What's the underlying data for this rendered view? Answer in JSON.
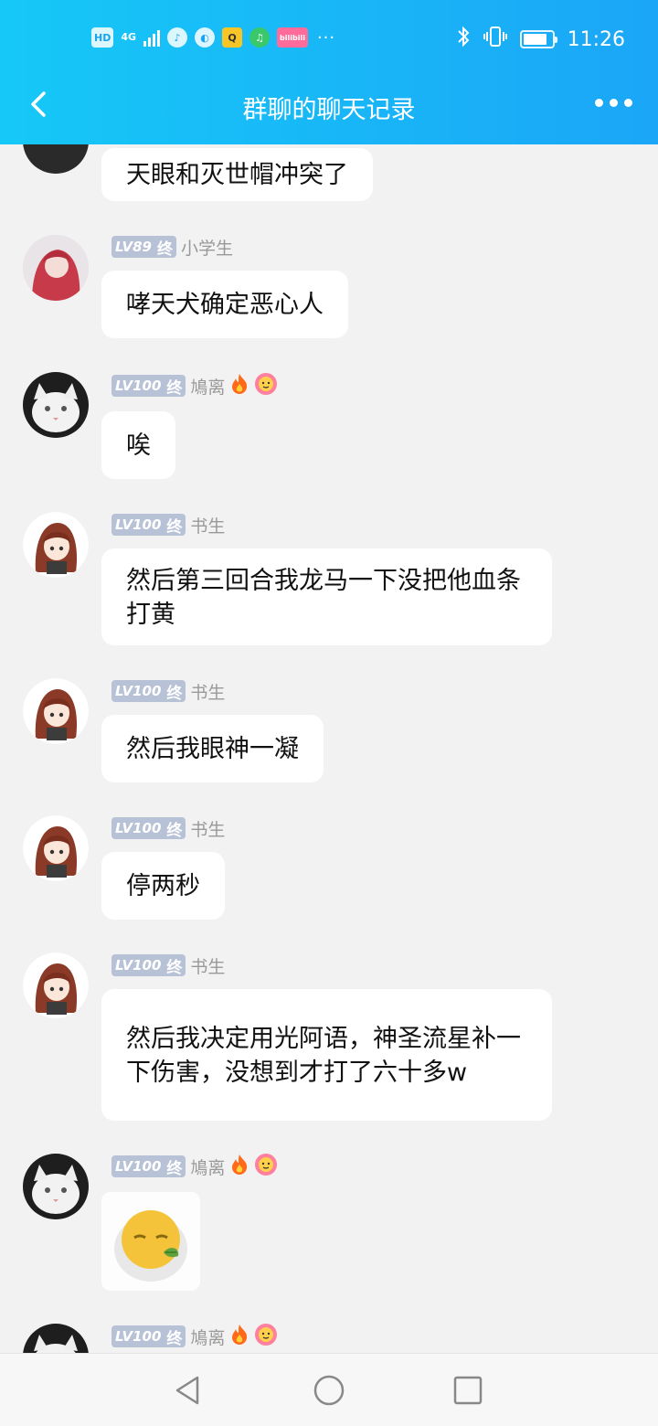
{
  "status_bar": {
    "hd": "HD",
    "network": "4G",
    "time": "11:26",
    "battery_level": 0.85,
    "bilibili": "bilibili",
    "more": "···"
  },
  "nav": {
    "title": "群聊的聊天记录"
  },
  "messages": [
    {
      "level": "",
      "name": "",
      "text": "天眼和灭世帽冲突了"
    },
    {
      "level": "LV89",
      "badge": "终",
      "name": "小学生",
      "text": "哮天犬确定恶心人"
    },
    {
      "level": "LV100",
      "badge": "终",
      "name": "鳩离",
      "text": "唉"
    },
    {
      "level": "LV100",
      "badge": "终",
      "name": "书生",
      "text": "然后第三回合我龙马一下没把他血条打黄"
    },
    {
      "level": "LV100",
      "badge": "终",
      "name": "书生",
      "text": "然后我眼神一凝"
    },
    {
      "level": "LV100",
      "badge": "终",
      "name": "书生",
      "text": "停两秒"
    },
    {
      "level": "LV100",
      "badge": "终",
      "name": "书生",
      "text": "然后我决定用光阿语，神圣流星补一下伤害，没想到才打了六十多w"
    },
    {
      "level": "LV100",
      "badge": "终",
      "name": "鳩离",
      "text": ""
    },
    {
      "level": "LV100",
      "badge": "终",
      "name": "鳩离",
      "text": ""
    }
  ]
}
